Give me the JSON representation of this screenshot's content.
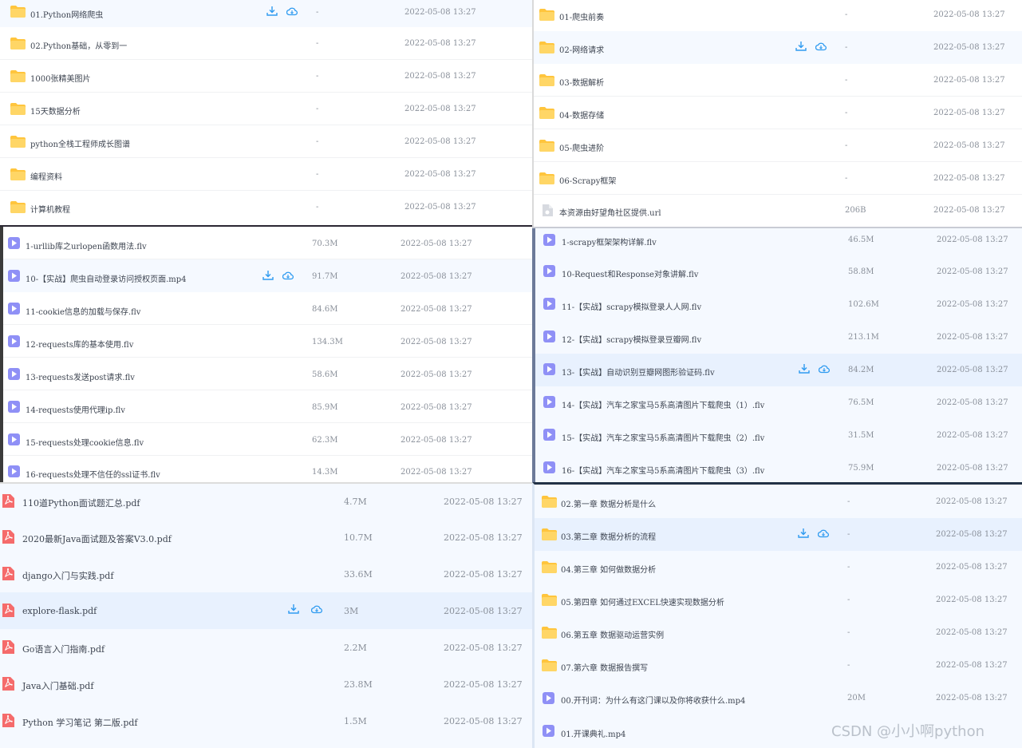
{
  "panels": {
    "top_left": {
      "rows": [
        {
          "name": "01.Python网络爬虫",
          "size": "-",
          "date": "2022-05-08 13:27"
        },
        {
          "name": "02.Python基础，从零到一",
          "size": "-",
          "date": "2022-05-08 13:27"
        },
        {
          "name": "1000张精美图片",
          "size": "-",
          "date": "2022-05-08 13:27"
        },
        {
          "name": "15天数据分析",
          "size": "-",
          "date": "2022-05-08 13:27"
        },
        {
          "name": "python全栈工程师成长图谱",
          "size": "-",
          "date": "2022-05-08 13:27"
        },
        {
          "name": "编程资料",
          "size": "-",
          "date": "2022-05-08 13:27"
        },
        {
          "name": "计算机教程",
          "size": "-",
          "date": "2022-05-08 13:27"
        }
      ]
    },
    "top_right": {
      "rows": [
        {
          "name": "01-爬虫前奏",
          "size": "-",
          "date": "2022-05-08 13:27"
        },
        {
          "name": "02-网络请求",
          "size": "-",
          "date": "2022-05-08 13:27"
        },
        {
          "name": "03-数据解析",
          "size": "-",
          "date": "2022-05-08 13:27"
        },
        {
          "name": "04-数据存储",
          "size": "-",
          "date": "2022-05-08 13:27"
        },
        {
          "name": "05-爬虫进阶",
          "size": "-",
          "date": "2022-05-08 13:27"
        },
        {
          "name": "06-Scrapy框架",
          "size": "-",
          "date": "2022-05-08 13:27"
        },
        {
          "name": "本资源由好望角社区提供.url",
          "size": "206B",
          "date": "2022-05-08 13:27"
        }
      ]
    },
    "mid_left": {
      "rows": [
        {
          "name": "1-urllib库之urlopen函数用法.flv",
          "size": "70.3M",
          "date": "2022-05-08 13:27"
        },
        {
          "name": "10-【实战】爬虫自动登录访问授权页面.mp4",
          "size": "91.7M",
          "date": "2022-05-08 13:27"
        },
        {
          "name": "11-cookie信息的加载与保存.flv",
          "size": "84.6M",
          "date": "2022-05-08 13:27"
        },
        {
          "name": "12-requests库的基本使用.flv",
          "size": "134.3M",
          "date": "2022-05-08 13:27"
        },
        {
          "name": "13-requests发送post请求.flv",
          "size": "58.6M",
          "date": "2022-05-08 13:27"
        },
        {
          "name": "14-requests使用代理ip.flv",
          "size": "85.9M",
          "date": "2022-05-08 13:27"
        },
        {
          "name": "15-requests处理cookie信息.flv",
          "size": "62.3M",
          "date": "2022-05-08 13:27"
        },
        {
          "name": "16-requests处理不信任的ssl证书.flv",
          "size": "14.3M",
          "date": "2022-05-08 13:27"
        }
      ]
    },
    "mid_right": {
      "rows": [
        {
          "name": "1-scrapy框架架构详解.flv",
          "size": "46.5M",
          "date": "2022-05-08 13:27"
        },
        {
          "name": "10-Request和Response对象讲解.flv",
          "size": "58.8M",
          "date": "2022-05-08 13:27"
        },
        {
          "name": "11-【实战】scrapy模拟登录人人网.flv",
          "size": "102.6M",
          "date": "2022-05-08 13:27"
        },
        {
          "name": "12-【实战】scrapy模拟登录豆瓣网.flv",
          "size": "213.1M",
          "date": "2022-05-08 13:27"
        },
        {
          "name": "13-【实战】自动识别豆瓣网图形验证码.flv",
          "size": "84.2M",
          "date": "2022-05-08 13:27"
        },
        {
          "name": "14-【实战】汽车之家宝马5系高清图片下载爬虫（1）.flv",
          "size": "76.5M",
          "date": "2022-05-08 13:27"
        },
        {
          "name": "15-【实战】汽车之家宝马5系高清图片下载爬虫（2）.flv",
          "size": "31.5M",
          "date": "2022-05-08 13:27"
        },
        {
          "name": "16-【实战】汽车之家宝马5系高清图片下载爬虫（3）.flv",
          "size": "75.9M",
          "date": "2022-05-08 13:27"
        }
      ]
    },
    "bottom_left": {
      "rows": [
        {
          "name": "110道Python面试题汇总.pdf",
          "size": "4.7M",
          "date": "2022-05-08 13:27"
        },
        {
          "name": "2020最新Java面试题及答案V3.0.pdf",
          "size": "10.7M",
          "date": "2022-05-08 13:27"
        },
        {
          "name": "django入门与实践.pdf",
          "size": "33.6M",
          "date": "2022-05-08 13:27"
        },
        {
          "name": "explore-flask.pdf",
          "size": "3M",
          "date": "2022-05-08 13:27"
        },
        {
          "name": "Go语言入门指南.pdf",
          "size": "2.2M",
          "date": "2022-05-08 13:27"
        },
        {
          "name": "Java入门基础.pdf",
          "size": "23.8M",
          "date": "2022-05-08 13:27"
        },
        {
          "name": "Python 学习笔记 第二版.pdf",
          "size": "1.5M",
          "date": "2022-05-08 13:27"
        }
      ]
    },
    "bottom_right": {
      "rows": [
        {
          "name": "02.第一章 数据分析是什么",
          "size": "-",
          "date": "2022-05-08 13:27"
        },
        {
          "name": "03.第二章 数据分析的流程",
          "size": "-",
          "date": "2022-05-08 13:27"
        },
        {
          "name": "04.第三章 如何做数据分析",
          "size": "-",
          "date": "2022-05-08 13:27"
        },
        {
          "name": "05.第四章 如何通过EXCEL快速实现数据分析",
          "size": "-",
          "date": "2022-05-08 13:27"
        },
        {
          "name": "06.第五章 数据驱动运营实例",
          "size": "-",
          "date": "2022-05-08 13:27"
        },
        {
          "name": "07.第六章 数据报告撰写",
          "size": "-",
          "date": "2022-05-08 13:27"
        },
        {
          "name": "00.开刊词：为什么有这门课以及你将收获什么.mp4",
          "size": "20M",
          "date": "2022-05-08 13:27"
        },
        {
          "name": "01.开课典礼.mp4",
          "size": "",
          "date": ""
        }
      ]
    }
  },
  "watermark": "CSDN @小小啊python",
  "colors": {
    "folder": "#ffc53d",
    "video": "#8f90f6",
    "pdf": "#f56b6b",
    "action": "#2f9bf0"
  }
}
